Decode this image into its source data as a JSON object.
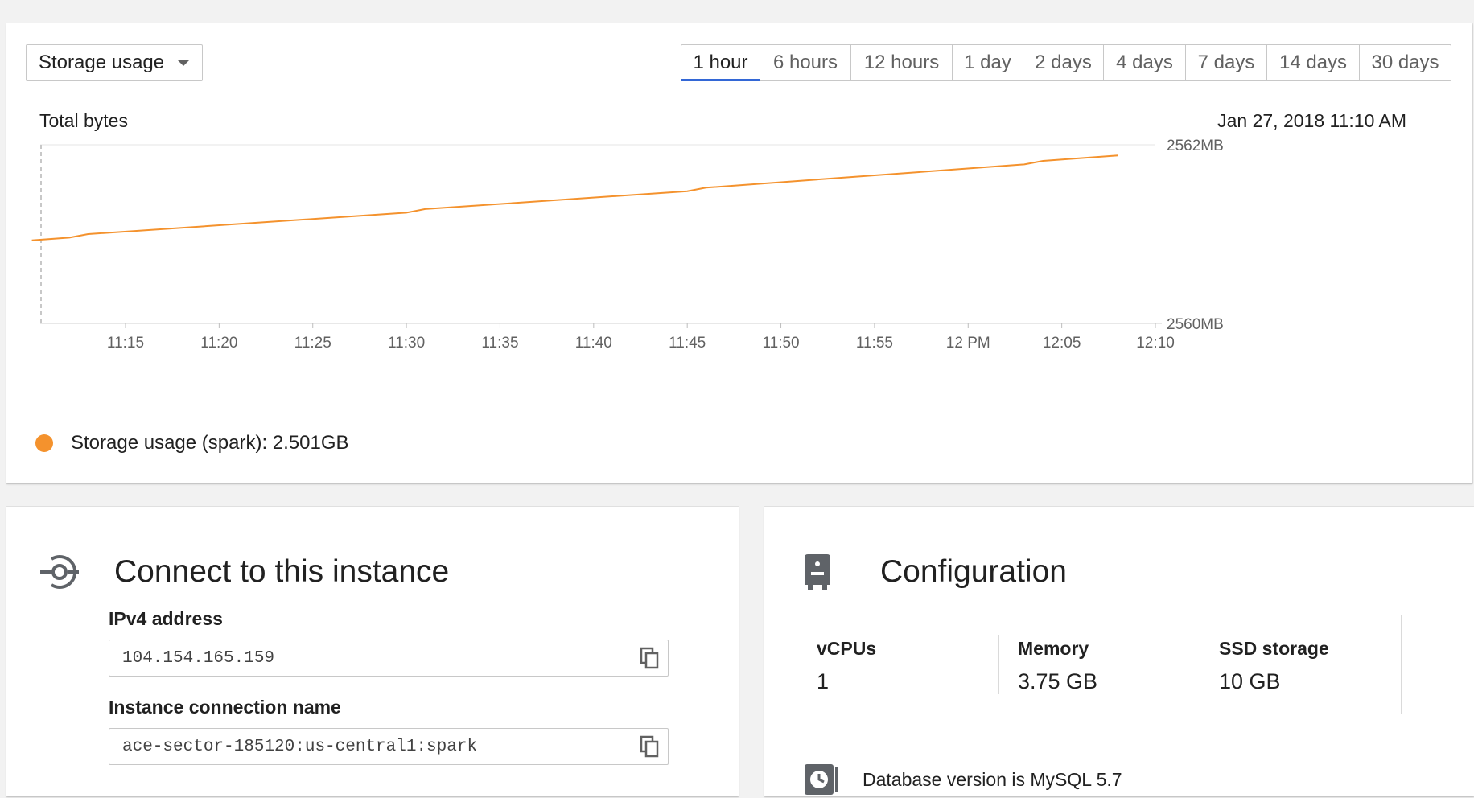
{
  "metric_selector": {
    "label": "Storage usage"
  },
  "time_ranges": [
    "1 hour",
    "6 hours",
    "12 hours",
    "1 day",
    "2 days",
    "4 days",
    "7 days",
    "14 days",
    "30 days"
  ],
  "active_time_range": "1 hour",
  "chart_data": {
    "type": "line",
    "title": "Total bytes",
    "timestamp": "Jan 27, 2018 11:10 AM",
    "x_tick_labels": [
      "11:15",
      "11:20",
      "11:25",
      "11:30",
      "11:35",
      "11:40",
      "11:45",
      "11:50",
      "11:55",
      "12 PM",
      "12:05",
      "12:10"
    ],
    "y_tick_labels": [
      "2562MB",
      "2560MB"
    ],
    "ylim": [
      2560,
      2562
    ],
    "y_unit": "MB",
    "series": [
      {
        "name": "Storage usage (spark)",
        "color": "#f4922d",
        "points": [
          [
            "11:10",
            2560.93
          ],
          [
            "11:12",
            2560.96
          ],
          [
            "11:13",
            2561.0
          ],
          [
            "11:30",
            2561.24
          ],
          [
            "11:31",
            2561.28
          ],
          [
            "11:45",
            2561.48
          ],
          [
            "11:46",
            2561.52
          ],
          [
            "12:03",
            2561.78
          ],
          [
            "12:04",
            2561.82
          ],
          [
            "12:08",
            2561.88
          ]
        ]
      }
    ],
    "legend": {
      "label": "Storage usage (spark): 2.501GB",
      "color": "#f4922d"
    }
  },
  "connect": {
    "title": "Connect to this instance",
    "icon": "connect-icon",
    "ipv4_label": "IPv4 address",
    "ipv4_value": "104.154.165.159",
    "conn_name_label": "Instance connection name",
    "conn_name_value": "ace-sector-185120:us-central1:spark"
  },
  "configuration": {
    "title": "Configuration",
    "icon": "storage-icon",
    "vcpus_label": "vCPUs",
    "vcpus_value": "1",
    "memory_label": "Memory",
    "memory_value": "3.75 GB",
    "ssd_label": "SSD storage",
    "ssd_value": "10 GB",
    "db_version_text": "Database version is MySQL 5.7"
  }
}
